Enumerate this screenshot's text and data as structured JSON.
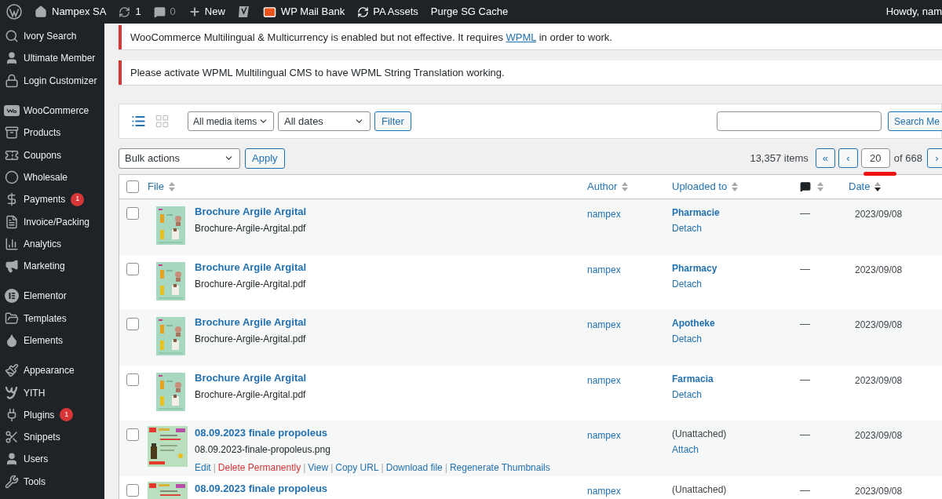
{
  "admin_bar": {
    "items": [
      {
        "kind": "logo"
      },
      {
        "kind": "home",
        "label": "Nampex SA"
      },
      {
        "kind": "updates",
        "label": "1"
      },
      {
        "kind": "comments",
        "label": "0"
      },
      {
        "kind": "new",
        "label": "New"
      },
      {
        "kind": "yoast"
      },
      {
        "kind": "mail",
        "label": "WP Mail Bank"
      },
      {
        "kind": "refresh",
        "label": "PA Assets"
      },
      {
        "kind": "text",
        "label": "Purge SG Cache"
      }
    ],
    "greeting": "Howdy, nam"
  },
  "sidebar": {
    "groups": [
      {
        "items": [
          {
            "kind": "search",
            "label": "Ivory Search"
          },
          {
            "kind": "user",
            "label": "Ultimate Member"
          },
          {
            "kind": "lock",
            "label": "Login Customizer"
          }
        ]
      },
      {
        "items": [
          {
            "kind": "woo",
            "label": "WooCommerce"
          },
          {
            "kind": "archive",
            "label": "Products"
          },
          {
            "kind": "ticket",
            "label": "Coupons"
          },
          {
            "kind": "circle",
            "label": "Wholesale"
          },
          {
            "kind": "dollar",
            "label": "Payments",
            "badge": "1"
          },
          {
            "kind": "file",
            "label": "Invoice/Packing"
          },
          {
            "kind": "chart",
            "label": "Analytics"
          },
          {
            "kind": "megaphone",
            "label": "Marketing"
          }
        ]
      },
      {
        "items": [
          {
            "kind": "elementor",
            "label": "Elementor"
          },
          {
            "kind": "folder",
            "label": "Templates"
          },
          {
            "kind": "drop",
            "label": "Elements"
          }
        ]
      },
      {
        "items": [
          {
            "kind": "brush",
            "label": "Appearance"
          },
          {
            "kind": "yith",
            "label": "YITH"
          },
          {
            "kind": "plug",
            "label": "Plugins",
            "badge": "1"
          },
          {
            "kind": "scissors",
            "label": "Snippets"
          },
          {
            "kind": "user",
            "label": "Users"
          },
          {
            "kind": "wrench",
            "label": "Tools"
          }
        ]
      }
    ]
  },
  "notices": [
    {
      "before": "WooCommerce Multilingual & Multicurrency is enabled but not effective. It requires ",
      "link": "WPML",
      "after": " in order to work."
    },
    {
      "before": "Please activate WPML Multilingual CMS to have WPML String Translation working."
    }
  ],
  "toolbar": {
    "view_modes": [
      {
        "kind": "list",
        "selected": true
      },
      {
        "kind": "grid",
        "selected": false
      }
    ],
    "type_filter": "All media items",
    "date_filter": "All dates",
    "filter_button": "Filter",
    "search_button": "Search Me"
  },
  "bulk": {
    "select": "Bulk actions",
    "apply": "Apply"
  },
  "pagination": {
    "count": "13,357 items",
    "first": "«",
    "prev": "‹",
    "page": "20",
    "of": "of 668",
    "next": "›"
  },
  "table": {
    "select_all_checked": false,
    "action_separator": "|",
    "columns": [
      {
        "kind": "file",
        "label": "File",
        "sorted": false
      },
      {
        "kind": "author",
        "label": "Author",
        "sorted": false
      },
      {
        "kind": "uploaded",
        "label": "Uploaded to",
        "sorted": false
      },
      {
        "kind": "comments",
        "sorted": false
      },
      {
        "kind": "date",
        "label": "Date",
        "sorted": true
      }
    ],
    "rows": [
      {
        "checked": false,
        "title": "Brochure Argile Argital",
        "filename": "Brochure-Argile-Argital.pdf",
        "author": "nampex",
        "uploaded_to": "Pharmacie",
        "attach_link": "Detach",
        "comments": "—",
        "date": "2023/09/08"
      },
      {
        "checked": false,
        "title": "Brochure Argile Argital",
        "filename": "Brochure-Argile-Argital.pdf",
        "author": "nampex",
        "uploaded_to": "Pharmacy",
        "attach_link": "Detach",
        "comments": "—",
        "date": "2023/09/08"
      },
      {
        "checked": false,
        "title": "Brochure Argile Argital",
        "filename": "Brochure-Argile-Argital.pdf",
        "author": "nampex",
        "uploaded_to": "Apotheke",
        "attach_link": "Detach",
        "comments": "—",
        "date": "2023/09/08"
      },
      {
        "checked": false,
        "title": "Brochure Argile Argital",
        "filename": "Brochure-Argile-Argital.pdf",
        "author": "nampex",
        "uploaded_to": "Farmacia",
        "attach_link": "Detach",
        "comments": "—",
        "date": "2023/09/08"
      },
      {
        "checked": false,
        "title": "08.09.2023 finale propoleus",
        "filename": "08.09.2023-finale-propoleus.png",
        "actions": [
          {
            "kind": "link",
            "label": "Edit"
          },
          {
            "kind": "danger",
            "label": "Delete Permanently"
          },
          {
            "kind": "link",
            "label": "View"
          },
          {
            "kind": "link",
            "label": "Copy URL"
          },
          {
            "kind": "link",
            "label": "Download file"
          },
          {
            "kind": "link",
            "label": "Regenerate Thumbnails"
          }
        ],
        "author": "nampex",
        "unattached": "(Unattached)",
        "attach_link": "Attach",
        "comments": "—",
        "date": "2023/09/08"
      },
      {
        "checked": false,
        "title": "08.09.2023 finale propoleus",
        "author": "nampex",
        "unattached": "(Unattached)",
        "comments": "—",
        "date": "2023/09/08"
      }
    ]
  }
}
